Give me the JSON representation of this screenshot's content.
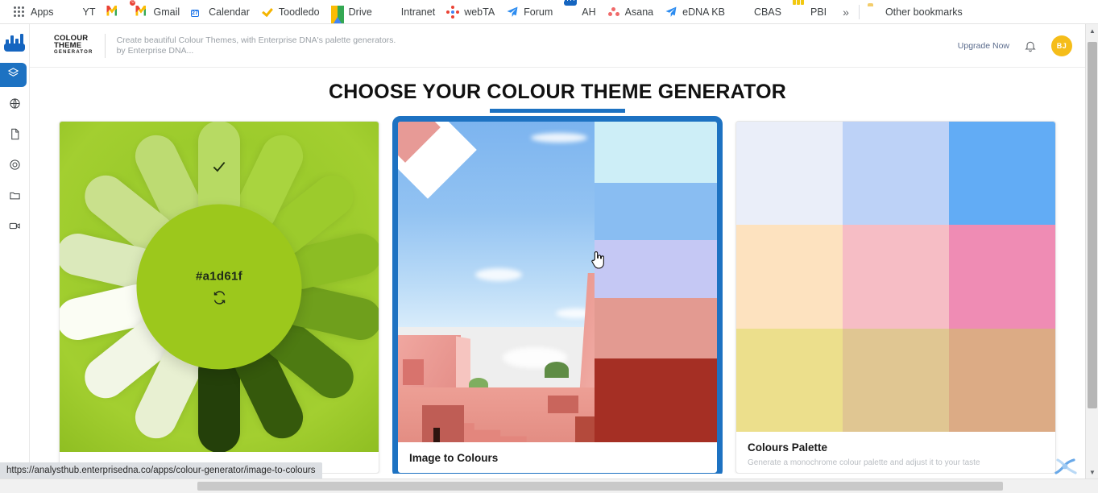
{
  "browser": {
    "bookmarks": [
      {
        "label": "Apps",
        "icon": "apps-grid-icon"
      },
      {
        "label": "YT",
        "icon": "youtube-icon"
      },
      {
        "label": "",
        "icon": "gmail-icon"
      },
      {
        "label": "Gmail",
        "icon": "gmail-badge-icon"
      },
      {
        "label": "Calendar",
        "icon": "calendar-icon"
      },
      {
        "label": "Toodledo",
        "icon": "checkmark-icon"
      },
      {
        "label": "Drive",
        "icon": "google-drive-icon"
      },
      {
        "label": "Intranet",
        "icon": "intranet-icon"
      },
      {
        "label": "webTA",
        "icon": "webta-icon"
      },
      {
        "label": "Forum",
        "icon": "paper-plane-icon"
      },
      {
        "label": "AH",
        "icon": "analyst-hub-icon"
      },
      {
        "label": "Asana",
        "icon": "asana-icon"
      },
      {
        "label": "eDNA KB",
        "icon": "paper-plane-icon"
      },
      {
        "label": "CBAS",
        "icon": "cbas-icon"
      },
      {
        "label": "PBI",
        "icon": "power-bi-icon"
      }
    ],
    "overflow_label": "»",
    "other_bookmarks_label": "Other bookmarks",
    "calendar_day": "27",
    "gmail_badge": "0",
    "status_url": "https://analysthub.enterprisedna.co/apps/colour-generator/image-to-colours"
  },
  "sidebar": {
    "items": [
      {
        "name": "apps",
        "icon": "layers-icon",
        "active": true
      },
      {
        "name": "web",
        "icon": "globe-icon",
        "active": false
      },
      {
        "name": "documents",
        "icon": "document-icon",
        "active": false
      },
      {
        "name": "targets",
        "icon": "target-icon",
        "active": false
      },
      {
        "name": "files",
        "icon": "folder-icon",
        "active": false
      },
      {
        "name": "videos",
        "icon": "video-icon",
        "active": false
      }
    ]
  },
  "header": {
    "logo_line1": "COLOUR",
    "logo_line2": "THEME",
    "logo_line3": "GENERATOR",
    "tagline_line1": "Create beautiful Colour Themes, with Enterprise DNA's palette generators.",
    "tagline_line2": "by Enterprise DNA...",
    "upgrade_label": "Upgrade Now",
    "notification_icon": "bell-icon",
    "avatar_initials": "BJ",
    "avatar_color": "#f5bd19"
  },
  "main": {
    "page_title": "CHOOSE YOUR COLOUR THEME GENERATOR",
    "accent_color": "#1d72c2",
    "cards": [
      {
        "title": "",
        "description": "",
        "type": "flower",
        "hex_code": "#a1d61f",
        "selected": false,
        "refresh_icon": "refresh-icon",
        "check_icon": "check-icon",
        "background_color": "#9ccb2c",
        "core_color": "#9cc81c",
        "petal_colors": [
          "#b7da63",
          "#a9d43f",
          "#9ccb2c",
          "#8cbd24",
          "#6f9f1c",
          "#4d7a12",
          "#35590c",
          "#24400a",
          "#e8f0d2",
          "#f2f6e6",
          "#fbfdf4",
          "#dbe9bb",
          "#c9e08c",
          "#bddb72"
        ]
      },
      {
        "title": "Image to Colours",
        "description": "",
        "type": "image",
        "selected": true,
        "cursor_icon": "hand-pointer-cursor",
        "swatch_colors": [
          "#cdeef7",
          "#89bdf2",
          "#c5c8f4",
          "#e39a91",
          "#a52f24"
        ]
      },
      {
        "title": "Colours Palette",
        "description": "Generate a monochrome colour palette and adjust it to your taste",
        "type": "palette",
        "selected": false,
        "grid_colors": [
          "#eaeef9",
          "#bdd2f7",
          "#62acf5",
          "#fde2bf",
          "#f6bdc5",
          "#ef8cb4",
          "#ecdf8c",
          "#e0c692",
          "#dcab85"
        ]
      }
    ]
  },
  "scrollbars": {
    "vertical_up_arrow": "▲",
    "vertical_down_arrow": "▼"
  }
}
